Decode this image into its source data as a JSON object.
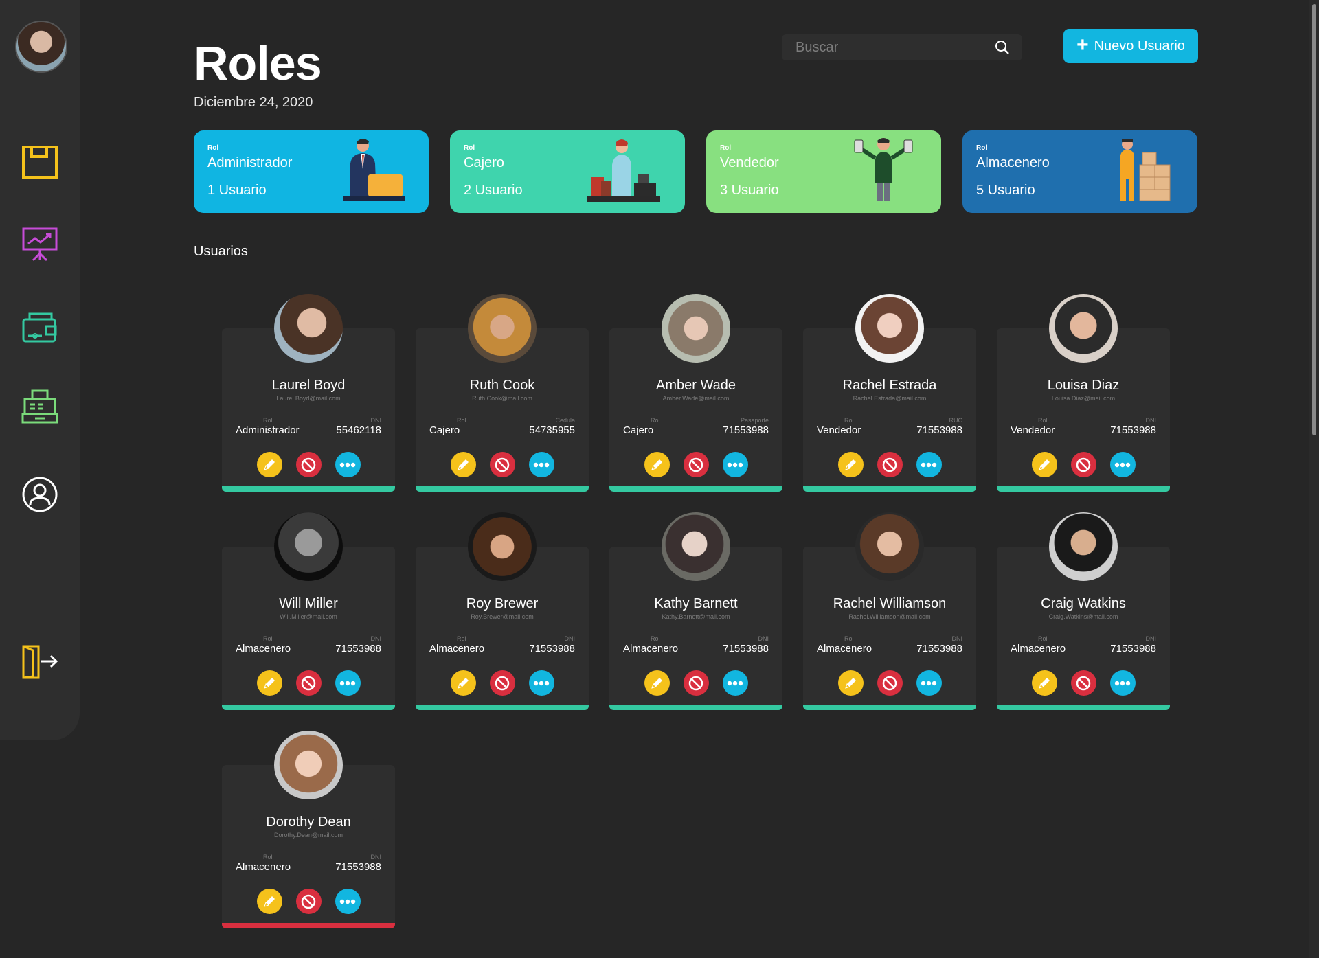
{
  "page": {
    "title": "Roles",
    "date": "Diciembre 24, 2020",
    "search_placeholder": "Buscar",
    "new_button": "Nuevo Usuario",
    "section_title": "Usuarios"
  },
  "sidebar": {
    "items": [
      {
        "name": "notes-icon",
        "color": "#f5c21b"
      },
      {
        "name": "presentation-chart-icon",
        "color": "#c74cd8"
      },
      {
        "name": "wallet-icon",
        "color": "#34c9a1"
      },
      {
        "name": "cash-register-icon",
        "color": "#7bdb7b"
      },
      {
        "name": "user-profile-icon",
        "color": "#ffffff"
      },
      {
        "name": "logout-icon",
        "color": "#f5c21b"
      }
    ]
  },
  "roles": [
    {
      "tag": "Rol",
      "name": "Administrador",
      "count": "1 Usuario",
      "color": "#10b5e2"
    },
    {
      "tag": "Rol",
      "name": "Cajero",
      "count": "2 Usuario",
      "color": "#3fd4ad"
    },
    {
      "tag": "Rol",
      "name": "Vendedor",
      "count": "3 Usuario",
      "color": "#88e080"
    },
    {
      "tag": "Rol",
      "name": "Almacenero",
      "count": "5 Usuario",
      "color": "#1f6fae"
    }
  ],
  "users": [
    {
      "name": "Laurel Boyd",
      "email": "Laurel.Boyd@mail.com",
      "role_label": "Rol",
      "role": "Administrador",
      "doc_label": "DNI",
      "doc": "55462118",
      "status_color": "#34c9a1"
    },
    {
      "name": "Ruth Cook",
      "email": "Ruth.Cook@mail.com",
      "role_label": "Rol",
      "role": "Cajero",
      "doc_label": "Cedula",
      "doc": "54735955",
      "status_color": "#34c9a1"
    },
    {
      "name": "Amber Wade",
      "email": "Amber.Wade@mail.com",
      "role_label": "Rol",
      "role": "Cajero",
      "doc_label": "Pasaporte",
      "doc": "71553988",
      "status_color": "#34c9a1"
    },
    {
      "name": "Rachel Estrada",
      "email": "Rachel.Estrada@mail.com",
      "role_label": "Rol",
      "role": "Vendedor",
      "doc_label": "RUC",
      "doc": "71553988",
      "status_color": "#34c9a1"
    },
    {
      "name": "Louisa Diaz",
      "email": "Louisa.Diaz@mail.com",
      "role_label": "Rol",
      "role": "Vendedor",
      "doc_label": "DNI",
      "doc": "71553988",
      "status_color": "#34c9a1"
    },
    {
      "name": "Will Miller",
      "email": "Will.Miller@mail.com",
      "role_label": "Rol",
      "role": "Almacenero",
      "doc_label": "DNI",
      "doc": "71553988",
      "status_color": "#34c9a1"
    },
    {
      "name": "Roy Brewer",
      "email": "Roy.Brewer@mail.com",
      "role_label": "Rol",
      "role": "Almacenero",
      "doc_label": "DNI",
      "doc": "71553988",
      "status_color": "#34c9a1"
    },
    {
      "name": "Kathy Barnett",
      "email": "Kathy.Barnett@mail.com",
      "role_label": "Rol",
      "role": "Almacenero",
      "doc_label": "DNI",
      "doc": "71553988",
      "status_color": "#34c9a1"
    },
    {
      "name": "Rachel Williamson",
      "email": "Rachel.Williamson@mail.com",
      "role_label": "Rol",
      "role": "Almacenero",
      "doc_label": "DNI",
      "doc": "71553988",
      "status_color": "#34c9a1"
    },
    {
      "name": "Craig Watkins",
      "email": "Craig.Watkins@mail.com",
      "role_label": "Rol",
      "role": "Almacenero",
      "doc_label": "DNI",
      "doc": "71553988",
      "status_color": "#34c9a1"
    },
    {
      "name": "Dorothy Dean",
      "email": "Dorothy.Dean@mail.com",
      "role_label": "Rol",
      "role": "Almacenero",
      "doc_label": "DNI",
      "doc": "71553988",
      "status_color": "#d92f3f"
    }
  ]
}
